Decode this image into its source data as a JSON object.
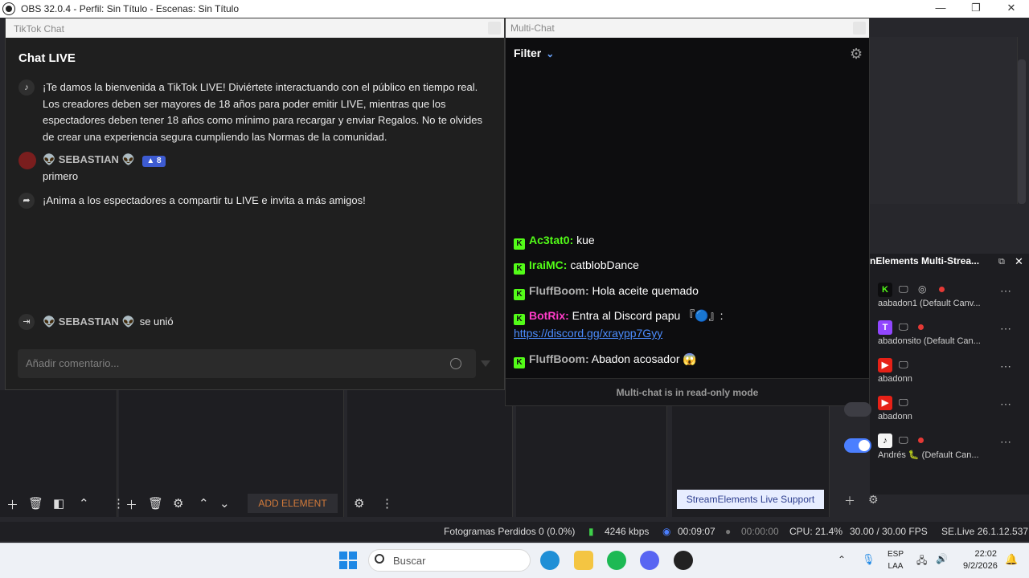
{
  "window": {
    "title": "OBS 32.0.4 - Perfil: Sin Título - Escenas: Sin Título",
    "minimize": "—",
    "maximize": "❐",
    "close": "✕"
  },
  "tiktok_chat": {
    "dock_title": "TikTok Chat",
    "heading": "Chat LIVE",
    "welcome": "¡Te damos la bienvenida a TikTok LIVE! Diviértete interactuando con el público en tiempo real. Los creadores deben ser mayores de 18 años para poder emitir LIVE, mientras que los espectadores deben tener 18 años como mínimo para recargar y enviar Regalos. No te olvides de crear una experiencia segura cumpliendo las Normas de la comunidad.",
    "user1_name": "👽 SEBASTIAN 👽",
    "user1_badge": "▲ 8",
    "user1_message": "primero",
    "share_prompt": "¡Anima a los espectadores a compartir tu LIVE e invita a más amigos!",
    "join_user": "👽 SEBASTIAN 👽",
    "join_text": "se unió",
    "comment_placeholder": "Añadir comentario..."
  },
  "multi_chat": {
    "dock_title": "Multi-Chat",
    "filter_label": "Filter",
    "messages": [
      {
        "user": "Ac3tat0:",
        "user_color": "#53fc18",
        "text": " kue"
      },
      {
        "user": "IraiMC:",
        "user_color": "#53fc18",
        "text": " catblobDance"
      },
      {
        "user": "FluffBoom:",
        "user_color": "#b0b0b0",
        "text": " Hola aceite quemado"
      },
      {
        "user": "BotRix:",
        "user_color": "#ff3cc8",
        "text": " Entra al Discord papu 『🔵』:"
      },
      {
        "user": "FluffBoom:",
        "user_color": "#b0b0b0",
        "text": " Abadon acosador 😱"
      }
    ],
    "link": "https://discord.gg/xraypp7Gyy",
    "readonly_notice": "Multi-chat is in read-only mode"
  },
  "se_multistream": {
    "title": "nElements Multi-Strea...",
    "rows": [
      {
        "platform": "K",
        "color": "#53fc18",
        "name": "aabadon1 (Default Canv...",
        "toggle": "off"
      },
      {
        "platform": "T",
        "color": "#9146ff",
        "name": "abadonsito (Default Can...",
        "toggle": "off"
      },
      {
        "platform": "▶",
        "color": "#e62117",
        "name": "abadonn",
        "toggle": "off"
      },
      {
        "platform": "▶",
        "color": "#e62117",
        "name": "abadonn",
        "toggle": "off"
      },
      {
        "platform": "♪",
        "color": "#111111",
        "name": "Andrés 🐛 (Default Can...",
        "toggle": "on"
      }
    ],
    "support_button": "StreamElements Live Support"
  },
  "toolbar": {
    "add_element": "ADD ELEMENT"
  },
  "statusbar": {
    "dropped": "Fotogramas Perdidos 0 (0.0%)",
    "bitrate": "4246 kbps",
    "stream_time": "00:09:07",
    "rec_time": "00:00:00",
    "cpu": "CPU: 21.4%",
    "fps": "30.00 / 30.00 FPS",
    "selive": "SE.Live 26.1.12.537"
  },
  "taskbar": {
    "search_placeholder": "Buscar",
    "lang_line1": "ESP",
    "lang_line2": "LAA",
    "time": "22:02",
    "date": "9/2/2026"
  }
}
